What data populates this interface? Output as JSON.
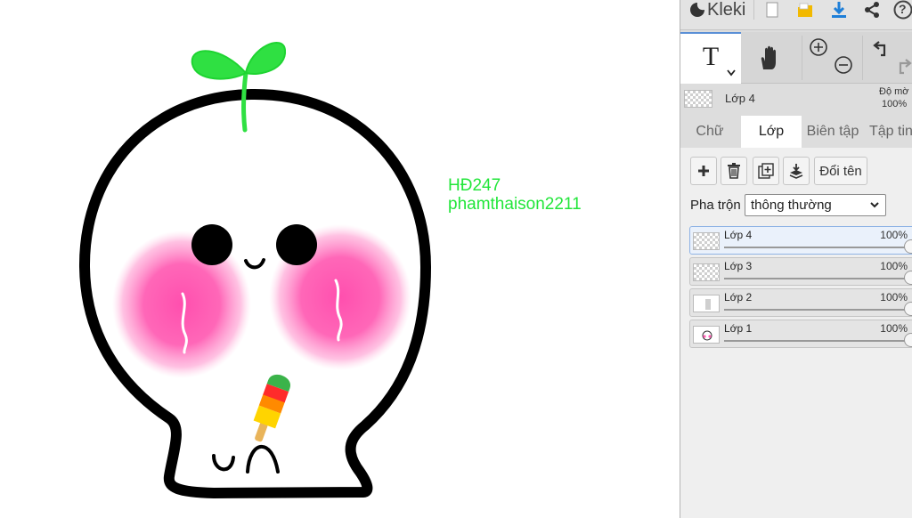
{
  "app": {
    "name": "Kleki"
  },
  "canvas": {
    "text_lines": [
      "HĐ247",
      "phamthaison2211"
    ],
    "text_color": "#22e63a"
  },
  "topbar": {
    "icons": [
      "kleki-logo-icon",
      "new-file-icon",
      "open-folder-icon",
      "download-icon",
      "share-icon",
      "help-icon"
    ],
    "help_label": "?"
  },
  "tools": {
    "active_tool": "text",
    "text_tool_label": "T",
    "items": [
      "text-tool",
      "hand-tool",
      "zoom-in-tool",
      "zoom-out-tool",
      "undo-tool",
      "redo-tool"
    ]
  },
  "layer_info": {
    "name": "Lớp 4",
    "opacity_label": "Độ mờ",
    "opacity_value": "100%"
  },
  "tabs": [
    {
      "label": "Chữ",
      "active": false
    },
    {
      "label": "Lớp",
      "active": true
    },
    {
      "label": "Biên tập",
      "active": false
    },
    {
      "label": "Tập tin",
      "active": false
    }
  ],
  "layer_actions": {
    "rename_label": "Đổi tên"
  },
  "blend": {
    "label": "Pha trộn",
    "value": "thông thường"
  },
  "layers": [
    {
      "name": "Lớp 4",
      "opacity": "100%",
      "active": true
    },
    {
      "name": "Lớp 3",
      "opacity": "100%",
      "active": false
    },
    {
      "name": "Lớp 2",
      "opacity": "100%",
      "active": false
    },
    {
      "name": "Lớp 1",
      "opacity": "100%",
      "active": false
    }
  ],
  "colors": {
    "accent": "#5a8fd6",
    "panel_bg": "#dddddd",
    "blush": "#ff5fb4",
    "sprout": "#2fe042"
  }
}
